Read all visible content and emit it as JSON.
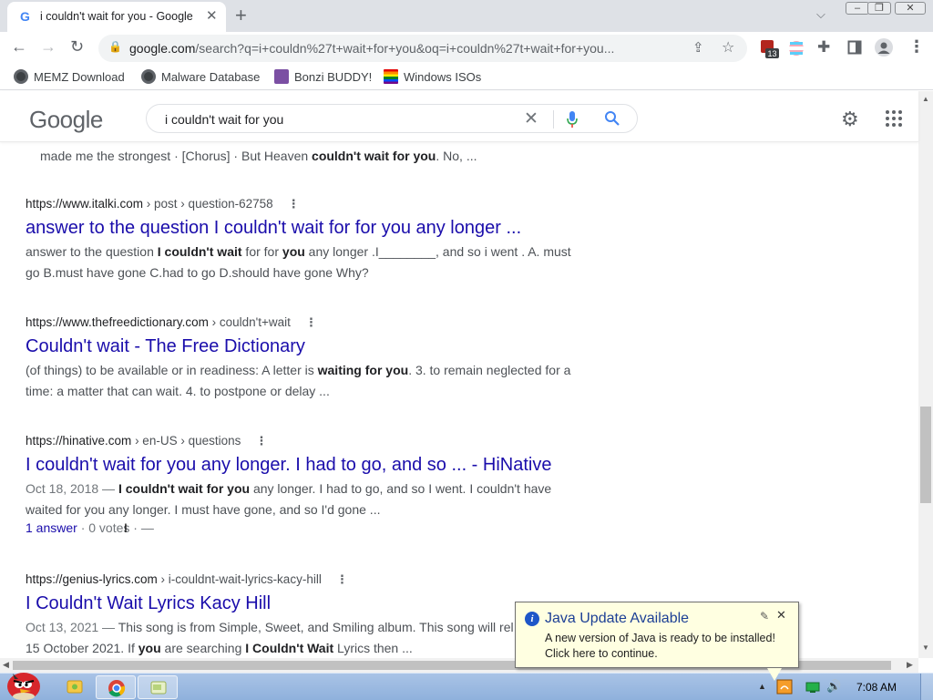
{
  "browser": {
    "tab_title": "i couldn't wait for you - Google",
    "url_host": "google.com",
    "url_rest": "/search?q=i+couldn%27t+wait+for+you&oq=i+couldn%27t+wait+for+you...",
    "extension_badge": "13"
  },
  "bookmarks": [
    {
      "label": "MEMZ Download"
    },
    {
      "label": "Malware Database"
    },
    {
      "label": "Bonzi BUDDY!"
    },
    {
      "label": "Windows ISOs"
    }
  ],
  "google": {
    "logo": "Google",
    "query": "i couldn't wait for you"
  },
  "results": {
    "prev_snippet": {
      "pre": "made me the strongest · [Chorus] · But Heaven ",
      "bold": "couldn't wait for you",
      "post": ". No, ..."
    },
    "items": [
      {
        "site": "https://www.italki.com",
        "path": " › post › question-62758",
        "title": "answer to the question I couldn't wait for for you any longer ...",
        "line1_a": "answer to the question ",
        "line1_b": "I couldn't wait",
        "line1_c": " for for ",
        "line1_d": "you",
        "line1_e": " any longer .I________, and so i went . A. must",
        "line2": "go B.must have gone C.had to go D.should have gone Why?"
      },
      {
        "site": "https://www.thefreedictionary.com",
        "path": " › couldn't+wait",
        "title": "Couldn't wait - The Free Dictionary",
        "line1_a": "(of things) to be available or in readiness: A letter is ",
        "line1_b": "waiting for you",
        "line1_c": ". 3. to remain neglected for a",
        "line2": "time: a matter that can wait. 4. to postpone or delay ..."
      },
      {
        "site": "https://hinative.com",
        "path": " › en-US › questions",
        "title": "I couldn't wait for you any longer. I had to go, and so ... - HiNative",
        "date": "Oct 18, 2018 — ",
        "line1_b": "I couldn't wait for you",
        "line1_c": " any longer. I had to go, and so I went. I couldn't have",
        "line2": "waited for you any longer. I must have gone, and so I'd gone ...",
        "answers_link": "1 answer",
        "votes": " · 0 votes · —"
      },
      {
        "site": "https://genius-lyrics.com",
        "path": " › i-couldnt-wait-lyrics-kacy-hill",
        "title": "I Couldn't Wait Lyrics Kacy Hill",
        "date": "Oct 13, 2021 — ",
        "line1_c": "This song is from Simple, Sweet, and Smiling album. This song will rel",
        "line2_a": "15 October 2021. If ",
        "line2_b": "you",
        "line2_c": " are searching ",
        "line2_d": "I Couldn't Wait",
        "line2_e": " Lyrics then ..."
      }
    ]
  },
  "notification": {
    "title": "Java Update Available",
    "line1": "A new version of Java is ready to be installed!",
    "line2": "Click here to continue."
  },
  "taskbar": {
    "clock": "7:08 AM"
  }
}
